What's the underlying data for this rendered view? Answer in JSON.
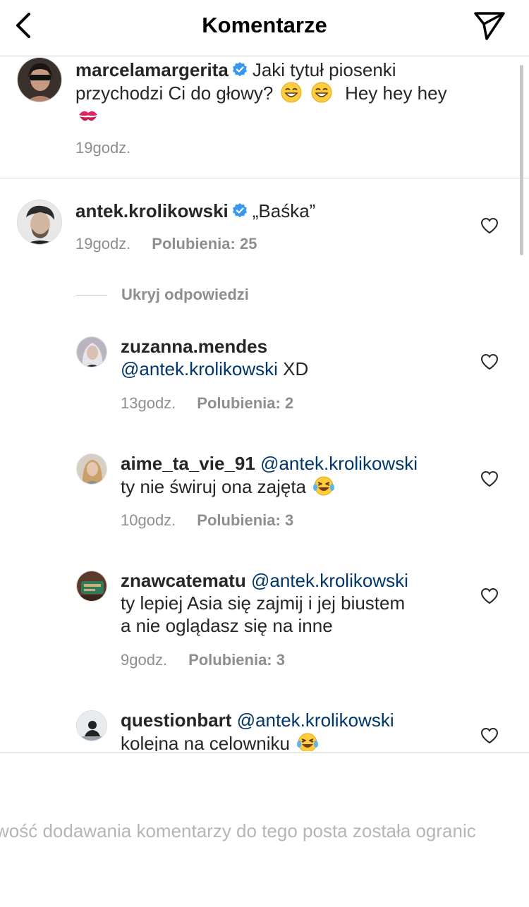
{
  "header": {
    "title": "Komentarze",
    "back_icon": "chevron-left-icon",
    "send_icon": "direct-send-icon"
  },
  "caption": {
    "username": "marcelamargerita",
    "verified": true,
    "text_line1": "Jaki tytuł piosenki",
    "text_line2": "przychodzi Ci do głowy?",
    "text_line2_after": "Hey hey hey",
    "emojis": [
      "grinning-face-emoji",
      "grinning-face-emoji",
      "kiss-mark-emoji"
    ],
    "time": "19godz."
  },
  "comment": {
    "username": "antek.krolikowski",
    "verified": true,
    "text": "„Baśka”",
    "time": "19godz.",
    "likes": "Polubienia: 25",
    "hide_replies": "Ukryj odpowiedzi"
  },
  "replies": [
    {
      "username": "zuzanna.mendes",
      "mention": "@antek.krolikowski",
      "text": "XD",
      "time": "13godz.",
      "likes": "Polubienia: 2"
    },
    {
      "username": "aime_ta_vie_91",
      "mention": "@antek.krolikowski",
      "text": "ty nie świruj ona zajęta",
      "emoji": "laughing-tears-emoji",
      "time": "10godz.",
      "likes": "Polubienia: 3"
    },
    {
      "username": "znawcatematu",
      "mention": "@antek.krolikowski",
      "text_line1": "ty lepiej Asia się zajmij i jej biustem",
      "text_line2": "a nie oglądasz się na inne",
      "time": "9godz.",
      "likes": "Polubienia: 3"
    },
    {
      "username": "questionbart",
      "mention": "@antek.krolikowski",
      "text": "kolejna na celowniku",
      "emoji": "laughing-tears-emoji"
    }
  ],
  "footer": {
    "notice": "wość dodawania komentarzy do tego posta została ogranic"
  },
  "colors": {
    "text": "#262626",
    "secondary": "#8e8e8e",
    "mention": "#00376b",
    "verified": "#3897f0",
    "divider": "#dbdbdb"
  }
}
